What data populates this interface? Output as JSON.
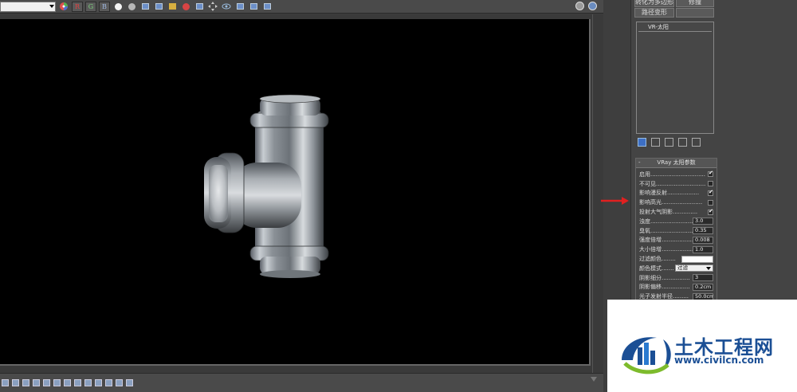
{
  "toolbar": {
    "channel_buttons": [
      "R",
      "G",
      "B"
    ]
  },
  "right_panel": {
    "top_buttons": [
      "转化为多边形",
      "修撞",
      "路径变形"
    ],
    "object_list_selected": "VR-太阳",
    "rollout_title": "VRay 太阳参数",
    "params": [
      {
        "label": "启用...............................",
        "type": "checkbox",
        "checked": true
      },
      {
        "label": "不可见............................",
        "type": "checkbox",
        "checked": false
      },
      {
        "label": "影响漫反射..................",
        "type": "checkbox",
        "checked": true
      },
      {
        "label": "影响高光.......................",
        "type": "checkbox",
        "checked": false
      },
      {
        "label": "投射大气阴影..............",
        "type": "checkbox",
        "checked": true
      },
      {
        "label": "浊度...........................",
        "type": "number",
        "value": "3.0"
      },
      {
        "label": "臭氧...........................",
        "type": "number",
        "value": "0.35"
      },
      {
        "label": "强度倍增...................",
        "type": "number",
        "value": "0.008"
      },
      {
        "label": "大小倍增...................",
        "type": "number",
        "value": "1.0"
      },
      {
        "label": "过滤颜色........",
        "type": "color",
        "value": "#ffffff"
      },
      {
        "label": "颜色模式.......",
        "type": "select",
        "value": "过滤"
      },
      {
        "label": "阴影细分................",
        "type": "number",
        "value": "3"
      },
      {
        "label": "阴影偏移................",
        "type": "number",
        "value": "0.2cm"
      },
      {
        "label": "光子发射半径.........",
        "type": "number",
        "value": "50.0cm"
      }
    ]
  },
  "watermark": {
    "title": "土木工程网",
    "url": "www.civilcn.com"
  },
  "colors": {
    "arrow": "#e02020",
    "watermark_blue": "#1b4f95",
    "viewport_bg": "#000000",
    "panel_bg": "#444444"
  }
}
